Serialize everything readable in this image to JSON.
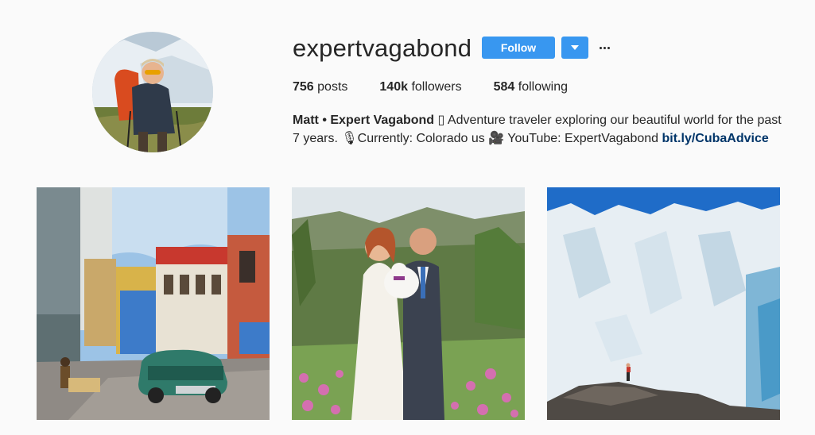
{
  "profile": {
    "username": "expertvagabond",
    "follow_label": "Follow",
    "stats": {
      "posts_count": "756",
      "posts_label": "posts",
      "followers_count": "140k",
      "followers_label": "followers",
      "following_count": "584",
      "following_label": "following"
    },
    "bio": {
      "name": "Matt • Expert Vagabond",
      "text": " ▯ Adventure traveler exploring our beautiful world for the past 7 years. 🎙Currently: Colorado us 🎥 YouTube: ExpertVagabond ",
      "link": "bit.ly/CubaAdvice"
    }
  },
  "posts": [
    {
      "subject": "havana-street-classic-car"
    },
    {
      "subject": "wedding-couple-with-cat"
    },
    {
      "subject": "glacier-hiker"
    }
  ],
  "colors": {
    "accent": "#3897f0",
    "link": "#003569",
    "background": "#fafafa"
  }
}
